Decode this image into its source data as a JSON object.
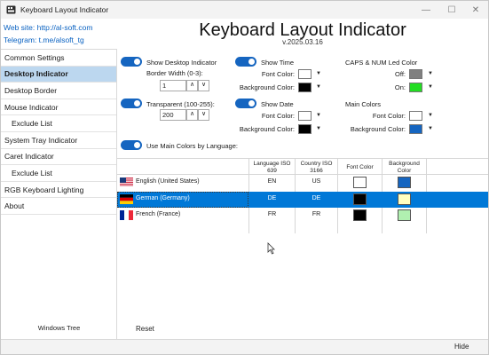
{
  "window": {
    "title": "Keyboard Layout Indicator",
    "controls": {
      "minimize": "—",
      "maximize": "☐",
      "close": "✕"
    }
  },
  "header": {
    "website": "Web site: http://al-soft.com",
    "telegram": "Telegram: t.me/alsoft_tg",
    "app_name": "Keyboard Layout Indicator",
    "version": "v.2025.03.16"
  },
  "sidebar": {
    "items": [
      {
        "label": "Common Settings",
        "sub": false,
        "active": false
      },
      {
        "label": "Desktop Indicator",
        "sub": false,
        "active": true
      },
      {
        "label": "Desktop Border",
        "sub": false,
        "active": false
      },
      {
        "label": "Mouse Indicator",
        "sub": false,
        "active": false
      },
      {
        "label": "Exclude List",
        "sub": true,
        "active": false
      },
      {
        "label": "System Tray Indicator",
        "sub": false,
        "active": false
      },
      {
        "label": "Caret Indicator",
        "sub": false,
        "active": false
      },
      {
        "label": "Exclude List",
        "sub": true,
        "active": false
      },
      {
        "label": "RGB Keyboard Lighting",
        "sub": false,
        "active": false
      },
      {
        "label": "About",
        "sub": false,
        "active": false
      }
    ],
    "footer": "Windows Tree"
  },
  "settings": {
    "show_desktop_indicator": {
      "label": "Show Desktop Indicator",
      "on": true
    },
    "border_width": {
      "label": "Border Width (0-3):",
      "value": "1"
    },
    "transparent": {
      "label": "Transparent (100-255):",
      "value": "200",
      "on": true
    },
    "use_main_colors": {
      "label": "Use Main Colors by Language:",
      "on": true
    },
    "show_time": {
      "label": "Show Time",
      "on": true,
      "font_label": "Font Color:",
      "font_color": "#ffffff",
      "bg_label": "Background Color:",
      "bg_color": "#000000"
    },
    "show_date": {
      "label": "Show Date",
      "on": true,
      "font_label": "Font Color:",
      "font_color": "#ffffff",
      "bg_label": "Background Color:",
      "bg_color": "#000000"
    },
    "caps_num": {
      "label": "CAPS & NUM Led Color",
      "off_label": "Off:",
      "off_color": "#808080",
      "on_label": "On:",
      "on_color": "#22dd22"
    },
    "main_colors": {
      "label": "Main Colors",
      "font_label": "Font Color:",
      "font_color": "#ffffff",
      "bg_label": "Background Color:",
      "bg_color": "#1565c0"
    }
  },
  "languages": {
    "headers": [
      "Language ISO 639",
      "Country ISO 3166",
      "Font Color",
      "Background Color"
    ],
    "rows": [
      {
        "name": "English (United States)",
        "lang": "EN",
        "country": "US",
        "font_color": "#ffffff",
        "bg_color": "#1565c0",
        "flag": "us",
        "selected": false
      },
      {
        "name": "German (Germany)",
        "lang": "DE",
        "country": "DE",
        "font_color": "#000000",
        "bg_color": "#ffffc0",
        "flag": "de",
        "selected": true
      },
      {
        "name": "French (France)",
        "lang": "FR",
        "country": "FR",
        "font_color": "#000000",
        "bg_color": "#b0f0b0",
        "flag": "fr",
        "selected": false
      }
    ]
  },
  "footer": {
    "reset": "Reset",
    "hide": "Hide"
  }
}
